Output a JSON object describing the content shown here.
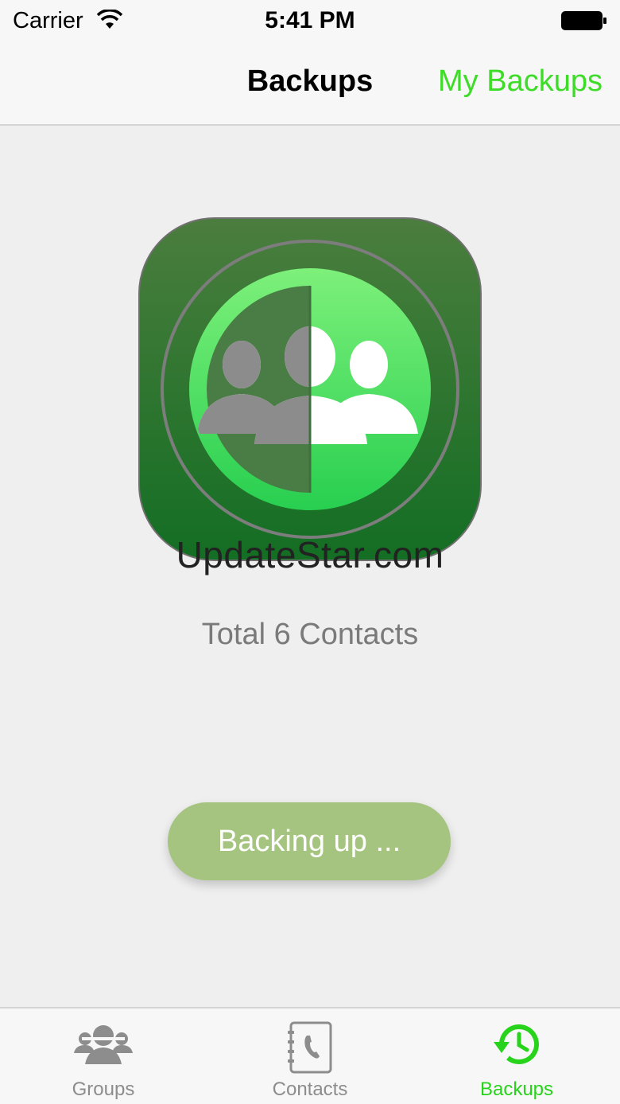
{
  "status_bar": {
    "carrier": "Carrier",
    "time": "5:41 PM",
    "wifi_icon": "wifi-icon",
    "battery_icon": "battery-icon"
  },
  "nav_bar": {
    "title": "Backups",
    "right_button": "My Backups",
    "accent_color": "#3ddc27"
  },
  "main": {
    "app_icon": "contacts-backup-app-icon",
    "watermark": "UpdateStar.com",
    "total_contacts": "Total 6 Contacts",
    "backup_button": "Backing up ..."
  },
  "tab_bar": {
    "tabs": [
      {
        "label": "Groups",
        "icon": "groups-icon",
        "active": false
      },
      {
        "label": "Contacts",
        "icon": "contacts-book-icon",
        "active": false
      },
      {
        "label": "Backups",
        "icon": "history-icon",
        "active": true
      }
    ],
    "active_color": "#27d31b",
    "inactive_color": "#8d8d8d"
  }
}
